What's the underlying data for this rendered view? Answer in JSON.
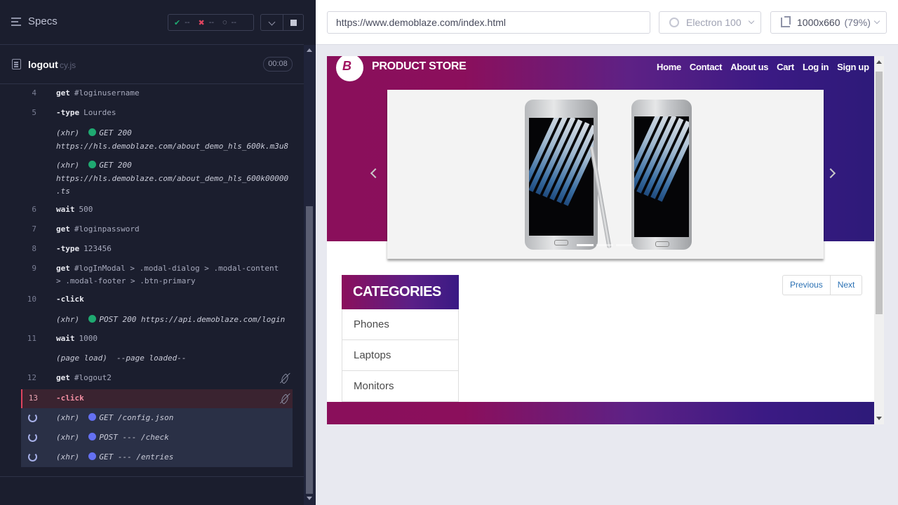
{
  "runner": {
    "specs_label": "Specs",
    "stats": {
      "passed": "--",
      "failed": "--",
      "pending": "--"
    },
    "spec": {
      "name": "logout",
      "ext": "cy.js",
      "duration": "00:08"
    },
    "commands": [
      {
        "num": "4",
        "verb": "get",
        "arg": "#loginusername"
      },
      {
        "num": "5",
        "verb": "-type",
        "arg": "Lourdes"
      },
      {
        "xhr_label": "(xhr)",
        "xhr": "GET 200",
        "url1": "https://hls.demoblaze.com/about_demo_hls_600k.m3u8"
      },
      {
        "xhr_label": "(xhr)",
        "xhr": "GET 200",
        "url1": "https://hls.demoblaze.com/about_demo_hls_600k00000",
        "url2": ".ts"
      },
      {
        "num": "6",
        "verb": "wait",
        "arg": "500"
      },
      {
        "num": "7",
        "verb": "get",
        "arg": "#loginpassword"
      },
      {
        "num": "8",
        "verb": "-type",
        "arg": "123456"
      },
      {
        "num": "9",
        "verb": "get",
        "arg": "#logInModal > .modal-dialog > .modal-content",
        "arg2": "> .modal-footer > .btn-primary"
      },
      {
        "num": "10",
        "verb": "-click",
        "arg": ""
      },
      {
        "xhr_label": "(xhr)",
        "xhr": "POST 200 https://api.demoblaze.com/login"
      },
      {
        "num": "11",
        "verb": "wait",
        "arg": "1000"
      },
      {
        "page_load": "(page load)",
        "page_load_text": "--page loaded--"
      },
      {
        "num": "12",
        "verb": "get",
        "arg": "#logout2"
      },
      {
        "num": "13",
        "verb": "-click",
        "arg": ""
      },
      {
        "xhr_label": "(xhr)",
        "xhr": "GET /config.json"
      },
      {
        "xhr_label": "(xhr)",
        "xhr": "POST --- /check"
      },
      {
        "xhr_label": "(xhr)",
        "xhr": "GET --- /entries"
      }
    ]
  },
  "preview": {
    "url": "https://www.demoblaze.com/index.html",
    "browser": "Electron 100",
    "viewport": "1000x660",
    "zoom": "(79%)"
  },
  "site": {
    "brand": "PRODUCT STORE",
    "logo_letter": "B",
    "nav": [
      "Home",
      "Contact",
      "About us",
      "Cart",
      "Log in",
      "Sign up"
    ],
    "categories_title": "CATEGORIES",
    "categories": [
      "Phones",
      "Laptops",
      "Monitors"
    ],
    "pager": {
      "previous": "Previous",
      "next": "Next"
    }
  },
  "colors": {
    "pass": "#1fa971",
    "fail": "#e0445f",
    "xhr_pending": "#6470f2",
    "brand_magenta": "#8b0f5c",
    "brand_indigo": "#2d1a79"
  }
}
